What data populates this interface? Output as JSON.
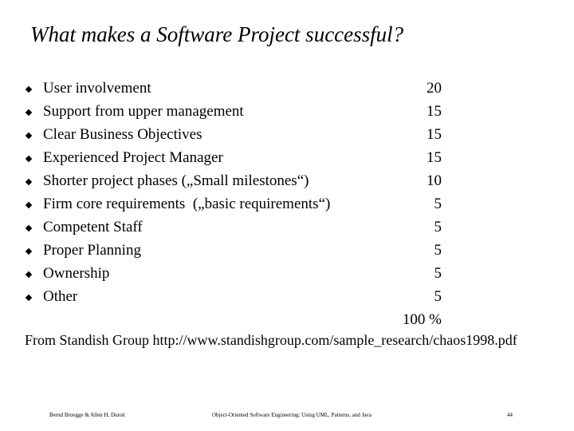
{
  "slide": {
    "title": "What makes a Software Project successful?",
    "items": [
      {
        "label": "User involvement",
        "value": "20"
      },
      {
        "label": "Support from upper management",
        "value": "15"
      },
      {
        "label": "Clear Business Objectives",
        "value": "15"
      },
      {
        "label": "Experienced Project Manager",
        "value": "15"
      },
      {
        "label": "Shorter project phases („Small milestones“)",
        "value": "10"
      },
      {
        "label": "Firm core requirements  („basic requirements“)",
        "value": "5"
      },
      {
        "label": "Competent Staff",
        "value": "5"
      },
      {
        "label": "Proper Planning",
        "value": "5"
      },
      {
        "label": "Ownership",
        "value": "5"
      },
      {
        "label": "Other",
        "value": "5"
      }
    ],
    "total": "100 %",
    "source": "From Standish Group http://www.standishgroup.com/sample_research/chaos1998.pdf"
  },
  "footer": {
    "authors": "Bernd Bruegge & Allen H. Dutoit",
    "book": "Object-Oriented Software Engineering: Using UML, Patterns, and Java",
    "page_number": "44"
  }
}
